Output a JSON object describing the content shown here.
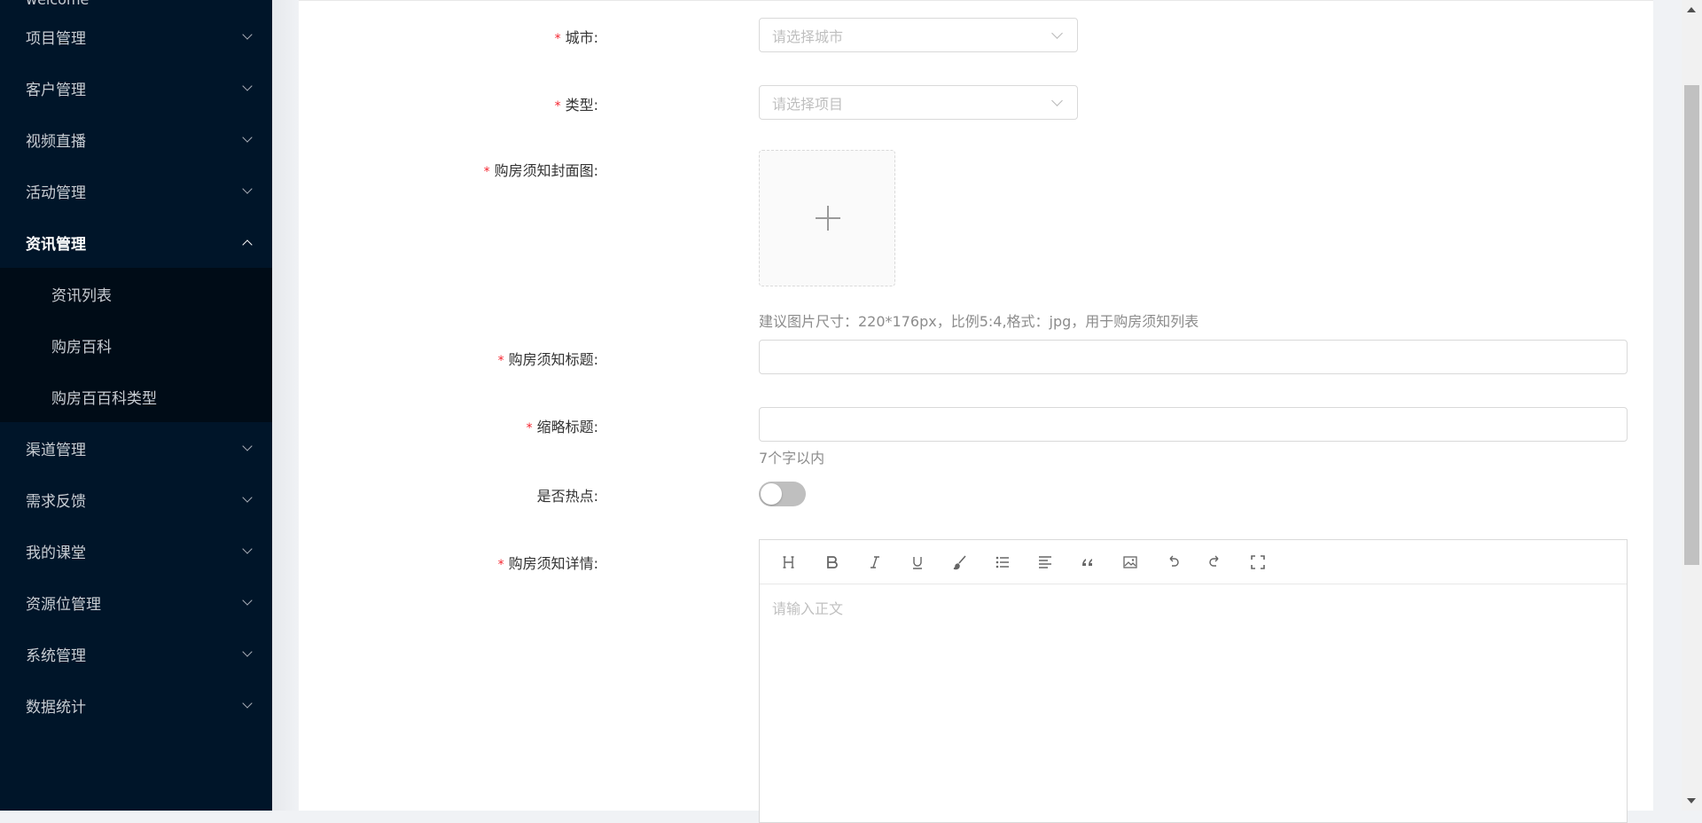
{
  "sidebar": {
    "top_label": "welcome",
    "items": [
      {
        "label": "项目管理"
      },
      {
        "label": "客户管理"
      },
      {
        "label": "视频直播"
      },
      {
        "label": "活动管理"
      },
      {
        "label": "资讯管理",
        "open": true
      },
      {
        "label": "渠道管理"
      },
      {
        "label": "需求反馈"
      },
      {
        "label": "我的课堂"
      },
      {
        "label": "资源位管理"
      },
      {
        "label": "系统管理"
      },
      {
        "label": "数据统计"
      }
    ],
    "subitems": [
      {
        "label": "资讯列表"
      },
      {
        "label": "购房百科"
      },
      {
        "label": "购房百百科类型"
      }
    ]
  },
  "form": {
    "city": {
      "label": "城市:",
      "placeholder": "请选择城市"
    },
    "type": {
      "label": "类型:",
      "placeholder": "请选择项目"
    },
    "cover": {
      "label": "购房须知封面图:",
      "hint": "建议图片尺寸：220*176px，比例5:4,格式：jpg，用于购房须知列表"
    },
    "title": {
      "label": "购房须知标题:",
      "value": ""
    },
    "short_title": {
      "label": "缩略标题:",
      "value": "",
      "hint": "7个字以内"
    },
    "hot": {
      "label": "是否热点:",
      "checked": false
    },
    "detail": {
      "label": "购房须知详情:",
      "placeholder": "请输入正文"
    },
    "required_mark": "*"
  },
  "editor_toolbar": [
    "heading-icon",
    "bold-icon",
    "italic-icon",
    "underline-icon",
    "brush-icon",
    "list-icon",
    "align-icon",
    "quote-icon",
    "image-icon",
    "undo-icon",
    "redo-icon",
    "fullscreen-icon"
  ],
  "colors": {
    "sidebar_bg": "#001529",
    "submenu_bg": "#000c17",
    "required": "#f5222d"
  }
}
